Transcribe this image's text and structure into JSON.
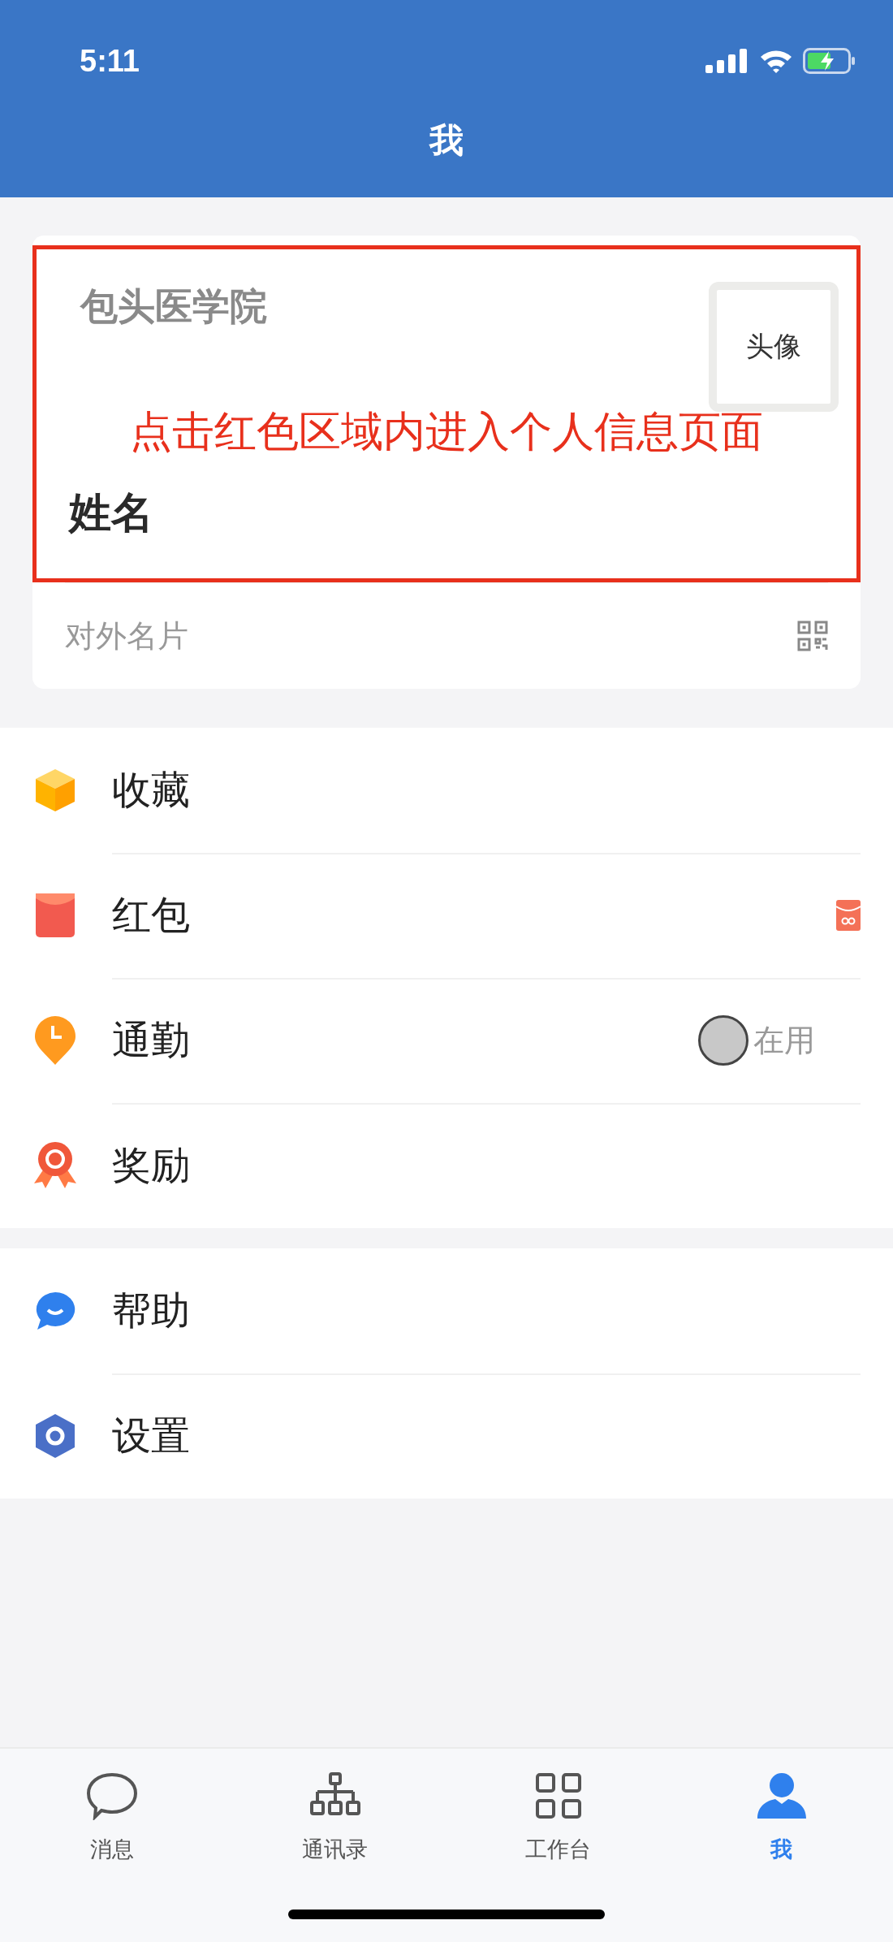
{
  "status_bar": {
    "time": "5:11"
  },
  "header": {
    "title": "我"
  },
  "profile": {
    "organization": "包头医学院",
    "avatar_label": "头像",
    "annotation": "点击红色区域内进入个人信息页面",
    "name": "姓名",
    "card_label": "对外名片"
  },
  "menu_sections": [
    {
      "items": [
        {
          "label": "收藏",
          "kind": "plain"
        },
        {
          "label": "红包",
          "kind": "badge"
        },
        {
          "label": "通勤",
          "kind": "status",
          "status": "在用"
        },
        {
          "label": "奖励",
          "kind": "plain"
        }
      ]
    },
    {
      "items": [
        {
          "label": "帮助",
          "kind": "plain"
        },
        {
          "label": "设置",
          "kind": "plain"
        }
      ]
    }
  ],
  "tabs": [
    {
      "label": "消息",
      "selected": false
    },
    {
      "label": "通讯录",
      "selected": false
    },
    {
      "label": "工作台",
      "selected": false
    },
    {
      "label": "我",
      "selected": true
    }
  ]
}
